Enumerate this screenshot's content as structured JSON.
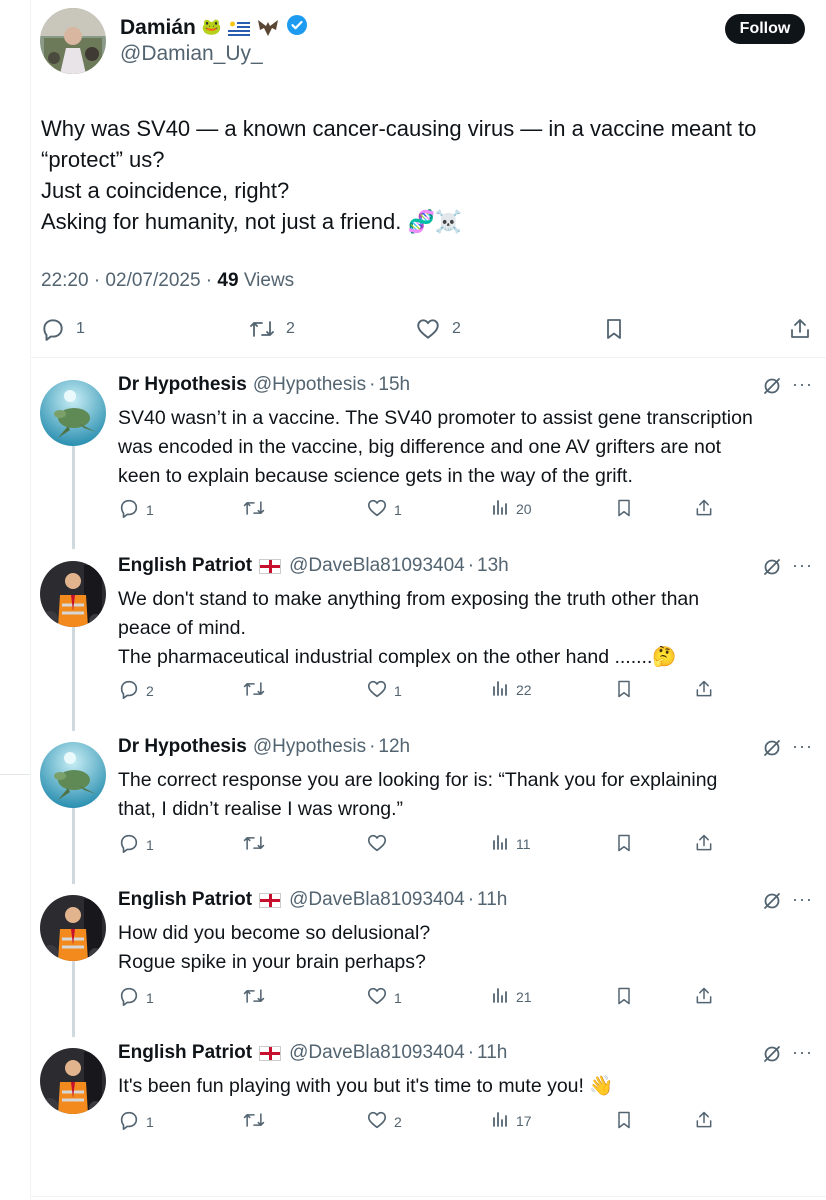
{
  "main": {
    "name": "Damián",
    "name_emojis": [
      "frog-emoji",
      "uruguay-flag-emoji",
      "bat-emoji"
    ],
    "handle": "@Damian_Uy_",
    "follow_label": "Follow",
    "text_lines": [
      "Why was SV40 — a known cancer-causing virus — in a vaccine meant to",
      "“protect” us?",
      "Just a coincidence, right?",
      "Asking for humanity, not just a friend. 🧬☠️"
    ],
    "time": "22:20 · 02/07/2025 · ",
    "views_count": "49",
    "views_label": " Views",
    "actions": {
      "replies": "1",
      "reposts": "2",
      "likes": "2"
    }
  },
  "replies": [
    {
      "name": "Dr Hypothesis",
      "handle": "@Hypothesis",
      "time": "15h",
      "avatar": "turtle-avatar",
      "lines": [
        "SV40 wasn’t in a vaccine. The SV40 promoter to assist gene transcription",
        "was encoded in the vaccine, big difference and one AV grifters are not",
        "keen to explain because science gets in the way of the grift."
      ],
      "replies": "1",
      "reposts": "",
      "likes": "1",
      "views": "20"
    },
    {
      "name": "English Patriot",
      "handle": "@DaveBla81093404",
      "time": "13h",
      "avatar": "man-in-hi-vis-avatar",
      "lines": [
        "We don't stand to make anything from exposing the truth other than",
        "peace of mind.",
        "The pharmaceutical industrial complex on the other hand .......🤔"
      ],
      "replies": "2",
      "reposts": "",
      "likes": "1",
      "views": "22"
    },
    {
      "name": "Dr Hypothesis",
      "handle": "@Hypothesis",
      "time": "12h",
      "avatar": "turtle-avatar",
      "lines": [
        "The correct response you are looking for is: “Thank you for explaining",
        "that, I didn’t realise I was wrong.”"
      ],
      "replies": "1",
      "reposts": "",
      "likes": "",
      "views": "11"
    },
    {
      "name": "English Patriot",
      "handle": "@DaveBla81093404",
      "time": "11h",
      "avatar": "man-in-hi-vis-avatar",
      "lines": [
        "How did you become so delusional?",
        "Rogue spike in your brain perhaps?"
      ],
      "replies": "1",
      "reposts": "",
      "likes": "1",
      "views": "21"
    },
    {
      "name": "English Patriot",
      "handle": "@DaveBla81093404",
      "time": "11h",
      "avatar": "man-in-hi-vis-avatar",
      "lines": [
        "It's been fun playing with you but it's time to mute you! 👋"
      ],
      "replies": "1",
      "reposts": "",
      "likes": "2",
      "views": "17"
    }
  ],
  "colors": {
    "text": "#0f1419",
    "muted": "#536471",
    "verified": "#1d9bf0",
    "follow_bg": "#0f1419"
  }
}
